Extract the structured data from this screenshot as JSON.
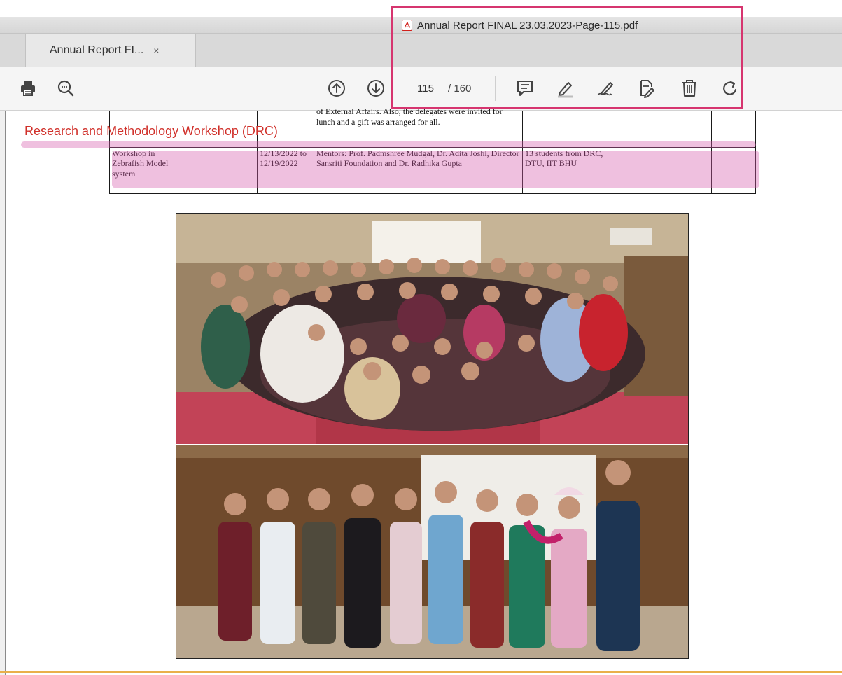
{
  "window": {
    "title": "Annual Report  FINAL  23.03.2023-Page-115.pdf",
    "title_icon": "pdf-file-icon"
  },
  "tabs": [
    {
      "label": "Annual Report  FI...",
      "close": "×"
    }
  ],
  "toolbar": {
    "icons": [
      "printer-icon",
      "zoom-icon",
      "page-up-icon",
      "page-down-icon",
      "comment-icon",
      "highlight-pen-icon",
      "sign-icon",
      "edit-pdf-icon",
      "trash-icon",
      "rotate-icon"
    ],
    "page_current": "115",
    "page_total": "/ 160"
  },
  "document": {
    "section_heading": "Research and Methodology Workshop (DRC)",
    "table": {
      "row1": {
        "description": "of External Affairs. Also, the delegates were invited for lunch and a gift was arranged for all."
      },
      "row2": {
        "activity": "Workshop in Zebrafish Model system",
        "date": "12/13/2022 to 12/19/2022",
        "description": "Mentors: Prof. Padmshree Mudgal, Dr. Adita Joshi, Director Sansriti Foundation and Dr. Radhika Gupta",
        "participants": "13 students from DRC, DTU, IIT BHU"
      }
    },
    "images": [
      "group-photo-workshop-participants",
      "group-photo-mentors"
    ]
  },
  "colors": {
    "heading_red": "#d0302a",
    "annotation_pink": "#d65aaa",
    "highlight_frame": "#d6356f"
  }
}
